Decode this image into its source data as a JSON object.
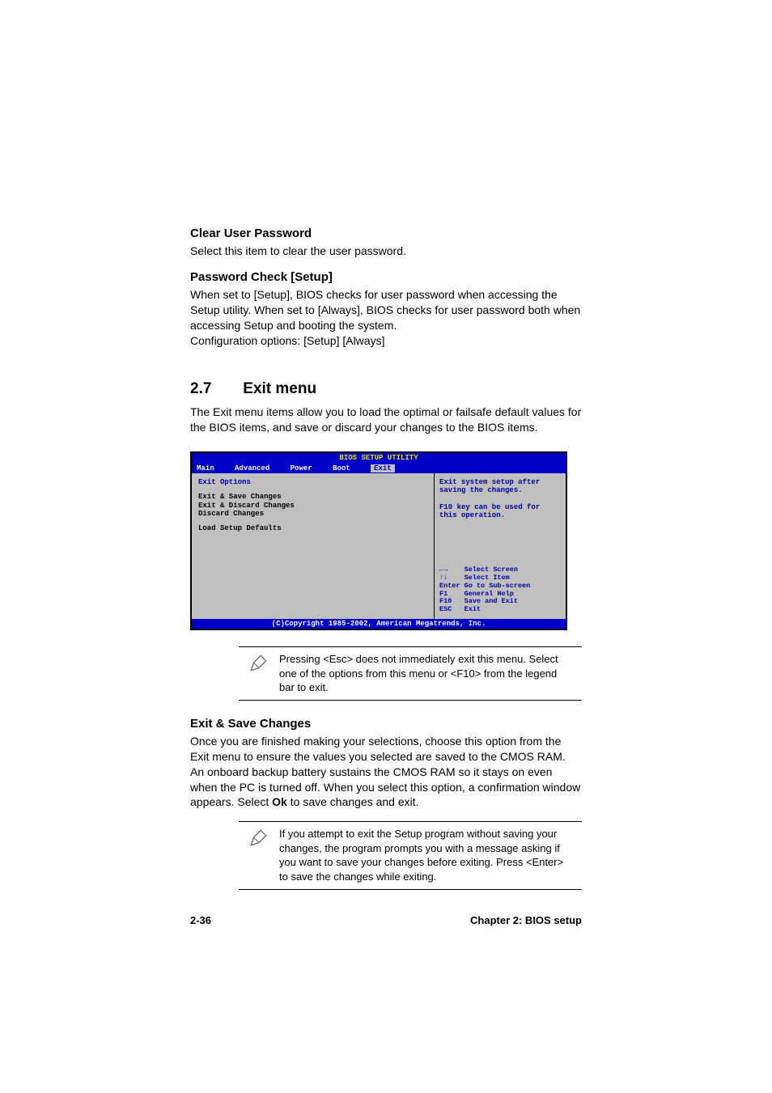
{
  "section1": {
    "heading": "Clear User Password",
    "body": "Select this item to clear the user password."
  },
  "section2": {
    "heading": "Password Check [Setup]",
    "body": "When set to [Setup], BIOS checks for user password when accessing the Setup utility. When set to [Always], BIOS checks for user password both when accessing Setup and booting the system.\nConfiguration options: [Setup] [Always]"
  },
  "chapter": {
    "number": "2.7",
    "title": "Exit menu",
    "intro": "The Exit menu items allow you to load the optimal or failsafe default values for the BIOS items, and save or discard your changes to the BIOS items."
  },
  "bios": {
    "title": "BIOS SETUP UTILITY",
    "tabs": {
      "main": "Main",
      "advanced": "Advanced",
      "power": "Power",
      "boot": "Boot",
      "exit": "Exit"
    },
    "options_title": "Exit Options",
    "options": [
      "Exit & Save Changes",
      "Exit & Discard Changes",
      "Discard Changes",
      "Load Setup Defaults"
    ],
    "help_top": "Exit system setup after saving the changes.\n\nF10 key can be used for this operation.",
    "keys": {
      "k1_key": "←→",
      "k1_label": "Select Screen",
      "k2_key": "↑↓",
      "k2_label": "Select Item",
      "k3_key": "Enter",
      "k3_label": "Go to Sub-screen",
      "k4_key": "F1",
      "k4_label": "General Help",
      "k5_key": "F10",
      "k5_label": "Save and Exit",
      "k6_key": "ESC",
      "k6_label": "Exit"
    },
    "footer": "(C)Copyright 1985-2002, American Megatrends, Inc."
  },
  "note1": {
    "text": "Pressing <Esc> does not immediately exit this menu. Select one of the options from this menu or <F10> from the legend bar to exit."
  },
  "section3": {
    "heading": "Exit & Save Changes",
    "body_part1": "Once you are finished making your selections, choose this option from the Exit menu to ensure the values you selected are saved to the CMOS RAM. An onboard backup battery sustains the CMOS RAM so it stays on even when the PC is turned off. When you select this option, a confirmation window appears. Select ",
    "ok_label": "Ok",
    "body_part2": " to save changes and exit."
  },
  "note2": {
    "text": "If you attempt to exit the Setup program without saving your changes, the program prompts you with a message asking if you want to save your changes before exiting. Press <Enter>  to save the  changes while exiting."
  },
  "footer": {
    "page": "2-36",
    "chapter": "Chapter 2: BIOS setup"
  }
}
